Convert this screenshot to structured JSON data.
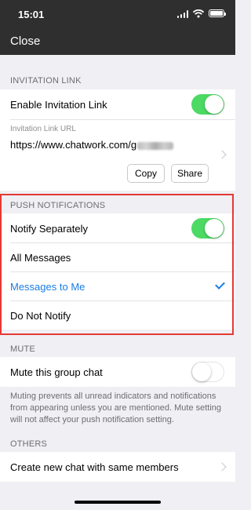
{
  "status_bar": {
    "time": "15:01",
    "icons": [
      "signal-icon",
      "wifi-icon",
      "battery-icon"
    ]
  },
  "header": {
    "close_label": "Close"
  },
  "invitation": {
    "section_title": "INVITATION LINK",
    "enable_label": "Enable Invitation Link",
    "enable_on": true,
    "url_caption": "Invitation Link URL",
    "url_value": "https://www.chatwork.com/g",
    "copy_label": "Copy",
    "share_label": "Share"
  },
  "push": {
    "section_title": "PUSH NOTIFICATIONS",
    "notify_separately_label": "Notify Separately",
    "notify_separately_on": true,
    "options": [
      {
        "label": "All Messages",
        "selected": false
      },
      {
        "label": "Messages to Me",
        "selected": true
      },
      {
        "label": "Do Not Notify",
        "selected": false
      }
    ]
  },
  "mute": {
    "section_title": "MUTE",
    "mute_label": "Mute this group chat",
    "mute_on": false,
    "description": "Muting prevents all unread indicators and notifications from appearing unless you are mentioned. Mute setting will not affect your push notification setting."
  },
  "others": {
    "section_title": "OTHERS",
    "create_label": "Create new chat with same members"
  },
  "colors": {
    "accent": "#1a7ce6",
    "toggle_on": "#4cd964",
    "highlight": "#e53935",
    "topbar": "#2f2f2f"
  }
}
